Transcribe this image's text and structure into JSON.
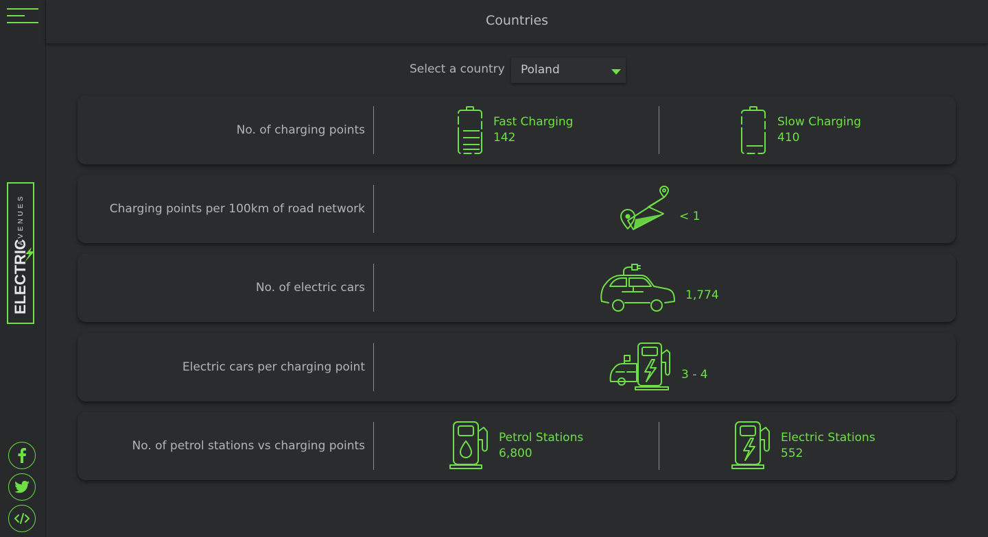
{
  "app": {
    "brand": "ELECTRIC AVENUES"
  },
  "header": {
    "title": "Countries"
  },
  "selector": {
    "label": "Select a country",
    "value": "Poland"
  },
  "rows": [
    {
      "label": "No. of charging points",
      "items": [
        {
          "title": "Fast Charging",
          "value": "142",
          "icon": "battery-full-icon"
        },
        {
          "title": "Slow Charging",
          "value": "410",
          "icon": "battery-low-icon"
        }
      ]
    },
    {
      "label": "Charging points per 100km of road network",
      "items": [
        {
          "value": "< 1",
          "icon": "road-route-icon"
        }
      ]
    },
    {
      "label": "No. of electric cars",
      "items": [
        {
          "value": "1,774",
          "icon": "electric-car-icon"
        }
      ]
    },
    {
      "label": "Electric cars per charging point",
      "items": [
        {
          "value": "3 - 4",
          "icon": "car-and-charger-icon"
        }
      ]
    },
    {
      "label": "No. of petrol stations vs charging points",
      "items": [
        {
          "title": "Petrol Stations",
          "value": "6,800",
          "icon": "petrol-pump-icon"
        },
        {
          "title": "Electric Stations",
          "value": "552",
          "icon": "electric-pump-icon"
        }
      ]
    }
  ],
  "social": [
    "facebook-icon",
    "twitter-icon",
    "code-icon"
  ],
  "colors": {
    "accent": "#6ee046",
    "background": "#2a2b2d",
    "text_muted": "#b4b4b4"
  }
}
